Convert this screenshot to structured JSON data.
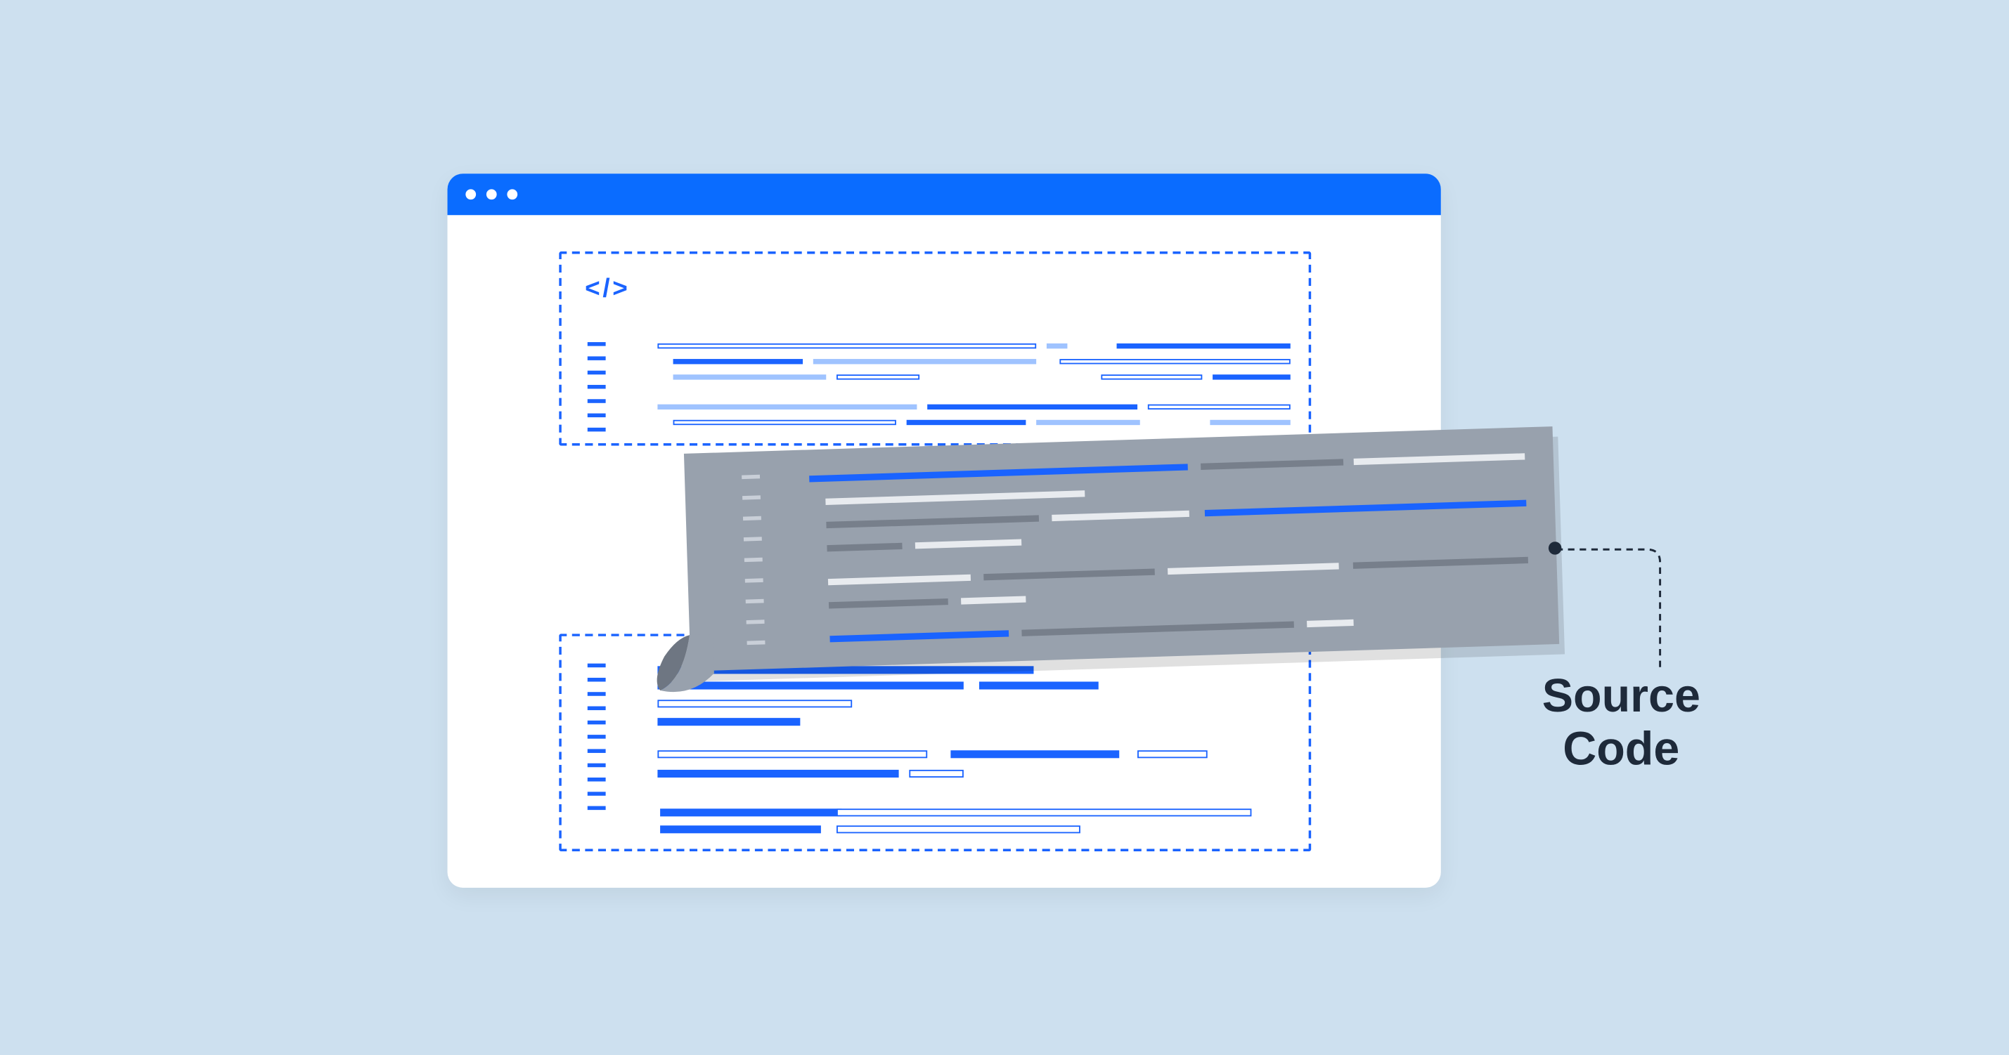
{
  "callout": {
    "label_line1": "Source",
    "label_line2": "Code"
  },
  "icons": {
    "code_tag": "</>"
  },
  "colors": {
    "background": "#cde0ef",
    "accent_blue": "#0a6cff",
    "dash_blue": "#1a63ff",
    "paper_grey": "#98a1ad",
    "text_dark": "#1e2a3a"
  }
}
